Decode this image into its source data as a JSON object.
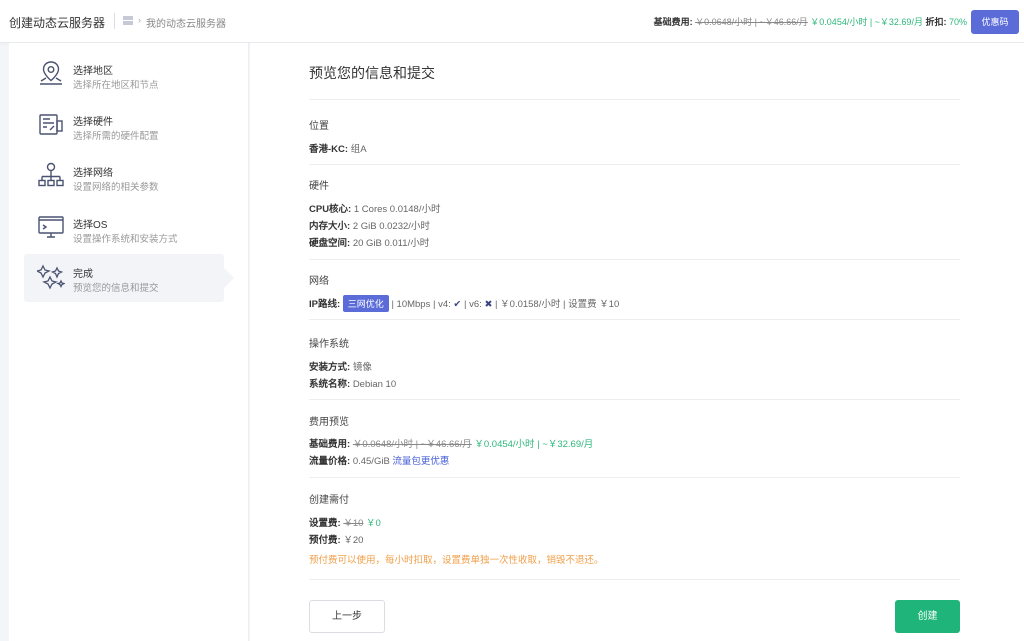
{
  "header": {
    "title": "创建动态云服务器",
    "breadcrumb_sep": "›",
    "breadcrumb": "我的动态云服务器",
    "price_label": "基础费用:",
    "price_old": "￥0.0648/小时 | ~￥46.66/月",
    "price_new": "￥0.0454/小时 | ~￥32.69/月",
    "discount_label": "折扣:",
    "discount_value": "70%",
    "promo_button": "优惠码"
  },
  "sidebar": {
    "steps": [
      {
        "title": "选择地区",
        "subtitle": "选择所在地区和节点",
        "icon": "map-pin-icon"
      },
      {
        "title": "选择硬件",
        "subtitle": "选择所需的硬件配置",
        "icon": "hardware-icon"
      },
      {
        "title": "选择网络",
        "subtitle": "设置网络的相关参数",
        "icon": "network-icon"
      },
      {
        "title": "选择OS",
        "subtitle": "设置操作系统和安装方式",
        "icon": "monitor-icon"
      },
      {
        "title": "完成",
        "subtitle": "预览您的信息和提交",
        "icon": "sparkle-icon"
      }
    ]
  },
  "main": {
    "title": "预览您的信息和提交",
    "location": {
      "section": "位置",
      "key": "香港-KC:",
      "value": "组A"
    },
    "hardware": {
      "section": "硬件",
      "cpu_key": "CPU核心:",
      "cpu_value": "1 Cores 0.0148/小时",
      "mem_key": "内存大小:",
      "mem_value": "2 GiB 0.0232/小时",
      "disk_key": "硬盘空间:",
      "disk_value": "20 GiB 0.011/小时"
    },
    "network": {
      "section": "网络",
      "key": "IP路线:",
      "chip": "三网优化",
      "text1": "| 10Mbps | v4:",
      "v4_icon": "✔",
      "text2": "| v6:",
      "v6_icon": "✖",
      "text3": "| ￥0.0158/小时 | 设置费 ￥10"
    },
    "os": {
      "section": "操作系统",
      "install_key": "安装方式:",
      "install_value": "镜像",
      "name_key": "系统名称:",
      "name_value": "Debian 10"
    },
    "cost": {
      "section": "费用预览",
      "base_key": "基础费用:",
      "base_old": "￥0.0648/小时 | ~￥46.66/月",
      "base_new": "￥0.0454/小时 | ~￥32.69/月",
      "traffic_key": "流量价格:",
      "traffic_value": "0.45/GiB",
      "traffic_link": "流量包更优惠"
    },
    "create_need": {
      "section": "创建需付",
      "setup_key": "设置费:",
      "setup_old": "￥10",
      "setup_new": "￥0",
      "prepay_key": "预付费:",
      "prepay_value": "￥20",
      "note": "预付费可以使用，每小时扣取，设置费单独一次性收取，销毁不退还。"
    },
    "back_button": "上一步",
    "create_button": "创建"
  }
}
